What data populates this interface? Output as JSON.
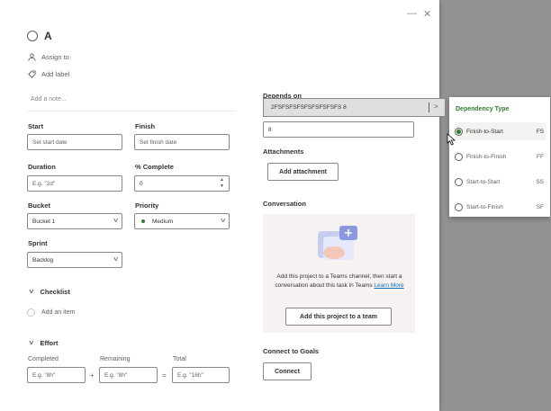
{
  "window": {
    "minimize_icon": "—",
    "close_icon": "✕"
  },
  "task": {
    "title": "A",
    "assign_to": "Assign to",
    "add_label": "Add label",
    "note_placeholder": "Add a note..."
  },
  "fields": {
    "start": {
      "label": "Start",
      "placeholder": "Set start date"
    },
    "finish": {
      "label": "Finish",
      "placeholder": "Set finish date"
    },
    "duration": {
      "label": "Duration",
      "placeholder": "E.g. \"2d\""
    },
    "complete": {
      "label": "% Complete",
      "value": "0"
    },
    "bucket": {
      "label": "Bucket",
      "value": "Bucket 1"
    },
    "priority": {
      "label": "Priority",
      "value": "Medium"
    },
    "sprint": {
      "label": "Sprint",
      "value": "Backlog"
    }
  },
  "checklist": {
    "label": "Checklist",
    "add_item": "Add an item"
  },
  "effort": {
    "label": "Effort",
    "completed": {
      "label": "Completed",
      "placeholder": "E.g. \"8h\""
    },
    "remaining": {
      "label": "Remaining",
      "placeholder": "E.g. \"8h\""
    },
    "total": {
      "label": "Total",
      "placeholder": "E.g. \"16h\""
    },
    "plus": "+",
    "equals": "="
  },
  "right": {
    "depends_on_label": "Depends on",
    "depends_on_value": "8",
    "dependency_chip": "2FSFSFSFSFSFSFSFSFS  8",
    "attachments_label": "Attachments",
    "add_attachment": "Add attachment",
    "conversation_label": "Conversation",
    "conversation_text": "Add this project to a Teams channel, then start a conversation about this task in Teams",
    "learn_more": "Learn More",
    "add_to_team": "Add this project to a team",
    "goals_label": "Connect to Goals",
    "connect": "Connect"
  },
  "dependency_popup": {
    "title": "Dependency Type",
    "options": [
      {
        "label": "Finish-to-Start",
        "code": "FS",
        "selected": true
      },
      {
        "label": "Finish-to-Finish",
        "code": "FF",
        "selected": false
      },
      {
        "label": "Start-to-Start",
        "code": "SS",
        "selected": false
      },
      {
        "label": "Start-to-Finish",
        "code": "SF",
        "selected": false
      }
    ]
  },
  "colors": {
    "accent": "#2e7d32",
    "link": "#0f6cbd",
    "backdrop": "#939393"
  }
}
